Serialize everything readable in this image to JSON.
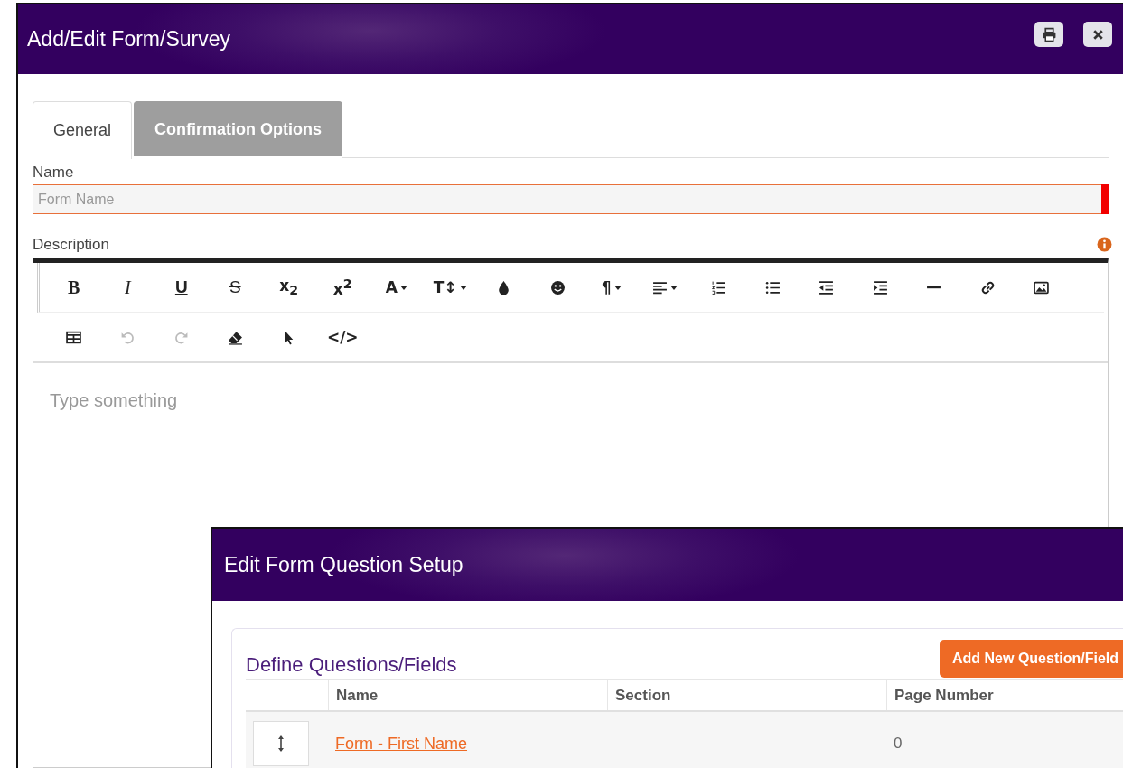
{
  "window": {
    "title": "Add/Edit Form/Survey"
  },
  "tabs": [
    {
      "label": "General",
      "selected": true
    },
    {
      "label": "Confirmation Options",
      "selected": false
    }
  ],
  "name_field": {
    "label": "Name",
    "placeholder": "Form Name",
    "required": true
  },
  "description": {
    "label": "Description",
    "toolbar": [
      [
        {
          "kind": "bold",
          "glyph": "B"
        },
        {
          "kind": "italic",
          "glyph": "I"
        },
        {
          "kind": "underline",
          "glyph": "U"
        },
        {
          "kind": "strike",
          "glyph": "S"
        },
        {
          "kind": "glyph",
          "glyph": "x$_{2}$"
        },
        {
          "kind": "glyph",
          "glyph": "x$^{2}$"
        },
        {
          "kind": "glyph",
          "glyph": "A",
          "caret": true
        },
        {
          "kind": "glyph",
          "glyph": "T↕",
          "caret": true
        },
        {
          "kind": "drop"
        },
        {
          "kind": "smiley"
        },
        {
          "kind": "glyph",
          "glyph": "¶",
          "caret": true
        },
        {
          "kind": "align",
          "caret": true
        },
        {
          "kind": "ordered-list"
        },
        {
          "kind": "bullet-list"
        },
        {
          "kind": "outdent"
        },
        {
          "kind": "indent"
        },
        {
          "kind": "rule"
        },
        {
          "kind": "link"
        },
        {
          "kind": "image"
        }
      ],
      [
        {
          "kind": "table"
        },
        {
          "kind": "undo",
          "disabled": true
        },
        {
          "kind": "redo",
          "disabled": true
        },
        {
          "kind": "eraser"
        },
        {
          "kind": "pointer"
        },
        {
          "kind": "glyph",
          "glyph": "</>"
        }
      ]
    ],
    "placeholder": "Type something"
  },
  "question_dialog": {
    "title": "Edit Form Question Setup",
    "panel_title": "Define Questions/Fields",
    "add_button": "Add New Question/Field",
    "columns": [
      "Name",
      "Section",
      "Page Number"
    ],
    "rows": [
      {
        "name": "Form - First Name",
        "page_number": "0"
      }
    ]
  }
}
